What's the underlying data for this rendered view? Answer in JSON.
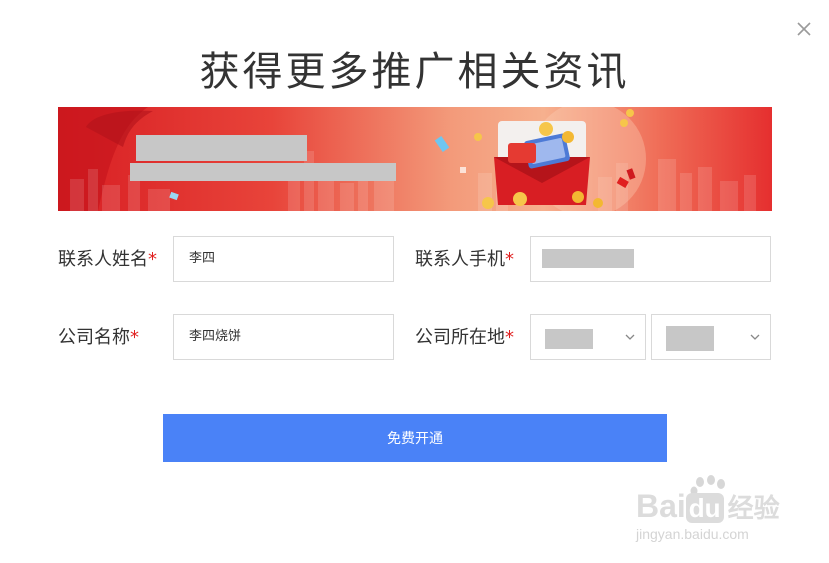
{
  "dialog": {
    "title": "获得更多推广相关资讯",
    "close_icon": "close-icon"
  },
  "form": {
    "contact_name": {
      "label": "联系人姓名",
      "required_mark": "*",
      "value": "李四"
    },
    "contact_phone": {
      "label": "联系人手机",
      "required_mark": "*",
      "value": ""
    },
    "company_name": {
      "label": "公司名称",
      "required_mark": "*",
      "value": "李四烧饼"
    },
    "company_location": {
      "label": "公司所在地",
      "required_mark": "*",
      "province": "",
      "city": "",
      "dropdown_icon": "chevron-down-icon"
    },
    "submit_label": "免费开通"
  },
  "colors": {
    "primary_button": "#4a82f7",
    "required_mark": "#e02020",
    "banner_red": "#d81e23"
  },
  "watermark": {
    "brand": "Bai",
    "brand2": "du",
    "cn": "经验",
    "url": "jingyan.baidu.com"
  }
}
